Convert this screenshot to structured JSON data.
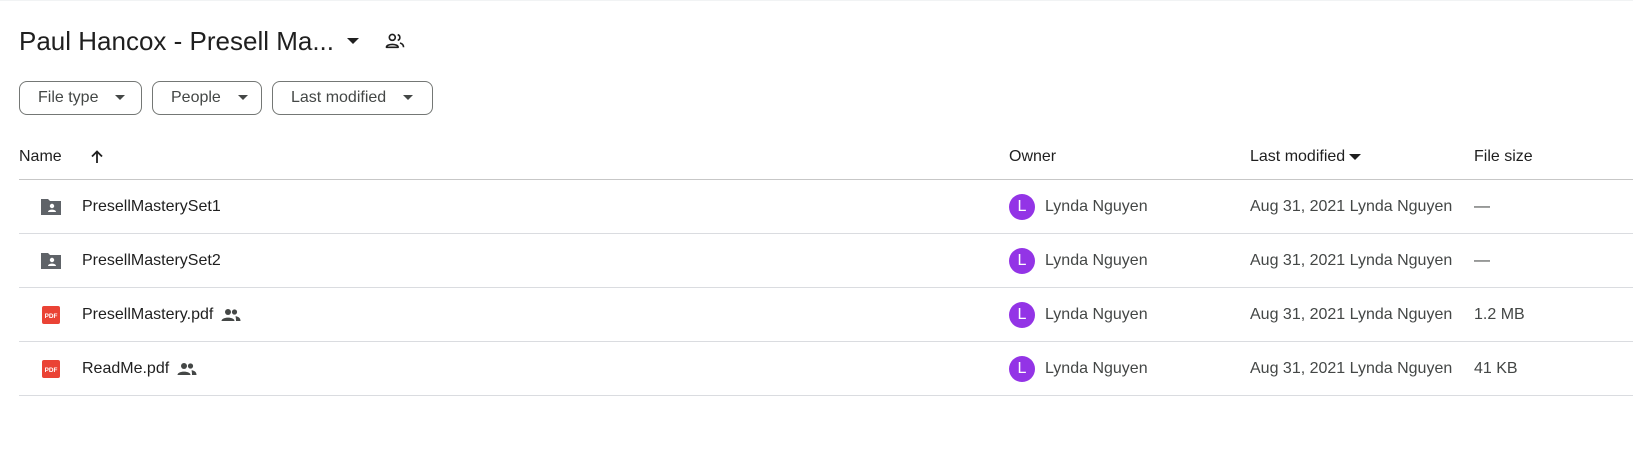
{
  "header": {
    "title": "Paul Hancox - Presell Ma...",
    "icons": {
      "caret": "arrow-drop-down-icon",
      "shared": "shared-people-icon"
    }
  },
  "filters": [
    {
      "label": "File type"
    },
    {
      "label": "People"
    },
    {
      "label": "Last modified"
    }
  ],
  "table": {
    "columns": {
      "name": "Name",
      "owner": "Owner",
      "modified": "Last modified",
      "size": "File size"
    },
    "rows": [
      {
        "type": "shared-folder",
        "name": "PresellMasterySet1",
        "shared": false,
        "owner_initial": "L",
        "owner": "Lynda Nguyen",
        "modified": "Aug 31, 2021 Lynda Nguyen",
        "size": "—"
      },
      {
        "type": "shared-folder",
        "name": "PresellMasterySet2",
        "shared": false,
        "owner_initial": "L",
        "owner": "Lynda Nguyen",
        "modified": "Aug 31, 2021 Lynda Nguyen",
        "size": "—"
      },
      {
        "type": "pdf",
        "name": "PresellMastery.pdf",
        "shared": true,
        "owner_initial": "L",
        "owner": "Lynda Nguyen",
        "modified": "Aug 31, 2021 Lynda Nguyen",
        "size": "1.2 MB"
      },
      {
        "type": "pdf",
        "name": "ReadMe.pdf",
        "shared": true,
        "owner_initial": "L",
        "owner": "Lynda Nguyen",
        "modified": "Aug 31, 2021 Lynda Nguyen",
        "size": "41 KB"
      }
    ]
  },
  "colors": {
    "avatar": "#9334e6",
    "pdf": "#ea4335",
    "folder": "#5f6368",
    "text": "#1f1f1f",
    "muted": "#444746"
  },
  "pdf_badge": "PDF"
}
